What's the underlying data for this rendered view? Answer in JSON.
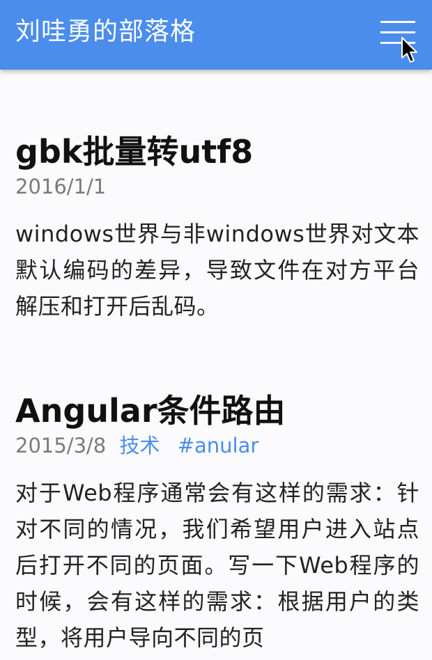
{
  "header": {
    "site_title": "刘哇勇的部落格",
    "menu_icon": "hamburger-menu-icon",
    "cursor_icon": "mouse-pointer-icon"
  },
  "colors": {
    "header_bg": "#4a8ded",
    "link": "#4a8ded",
    "meta": "#7a7a7a",
    "text": "#222222",
    "background": "#fbfbfd"
  },
  "posts": [
    {
      "title": "gbk批量转utf8",
      "date": "2016/1/1",
      "summary": "windows世界与非windows世界对文本默认编码的差异，导致文件在对方平台解压和打开后乱码。"
    },
    {
      "title": "Angular条件路由",
      "date": "2015/3/8",
      "category": "技术",
      "tag": "#anular",
      "summary": "对于Web程序通常会有这样的需求：针对不同的情况，我们希望用户进入站点后打开不同的页面。写一下Web程序的时候，会有这样的需求：根据用户的类型，将用户导向不同的页"
    }
  ]
}
